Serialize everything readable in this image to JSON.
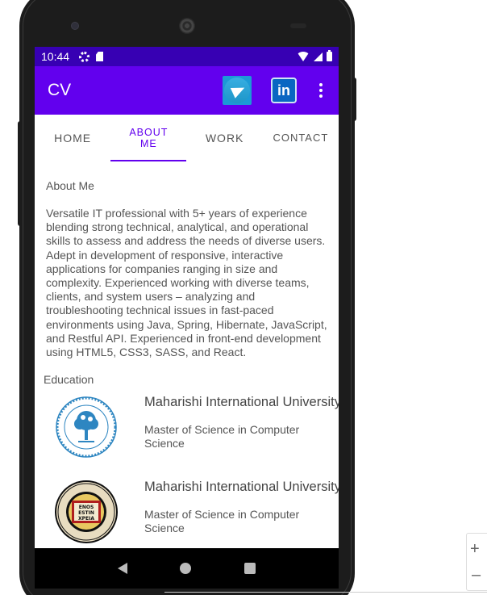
{
  "status_bar": {
    "time": "10:44",
    "icons": [
      "gear-icon",
      "sd-card-icon",
      "wifi-icon",
      "signal-icon",
      "battery-icon"
    ]
  },
  "app_bar": {
    "title": "CV",
    "actions": [
      "telegram-icon",
      "linkedin-icon",
      "more-vert-icon"
    ],
    "linkedin_text": "in"
  },
  "tabs": [
    {
      "label": "HOME",
      "active": false
    },
    {
      "label": "ABOUT ME",
      "active": true
    },
    {
      "label": "WORK",
      "active": false
    },
    {
      "label": "CONTACT",
      "active": false
    }
  ],
  "about": {
    "heading": "About Me",
    "text": " Versatile IT professional with 5+ years of experience blending strong technical, analytical, and operational skills to assess and address the needs of diverse users. Adept in development of responsive, interactive applications for companies ranging in size and complexity. Experienced working with diverse teams, clients, and system users – analyzing and troubleshooting technical issues in fast-paced environments using Java, Spring, Hibernate, JavaScript, and Restful API. Experienced in front-end development using HTML5, CSS3, SASS, and React."
  },
  "education": {
    "heading": "Education",
    "items": [
      {
        "school": "Maharishi International University",
        "degree": "Master of Science in Computer Science",
        "logo": "miu-seal-logo"
      },
      {
        "school": "Maharishi International University",
        "degree": "Master of Science in Computer Science",
        "logo": "bethany-lutheran-seal-logo"
      }
    ]
  },
  "nav_bar": {
    "icons": [
      "back-icon",
      "home-icon",
      "recents-icon"
    ]
  },
  "colors": {
    "status_bar": "#3700b3",
    "app_bar": "#6200ee",
    "accent": "#6200ee"
  }
}
